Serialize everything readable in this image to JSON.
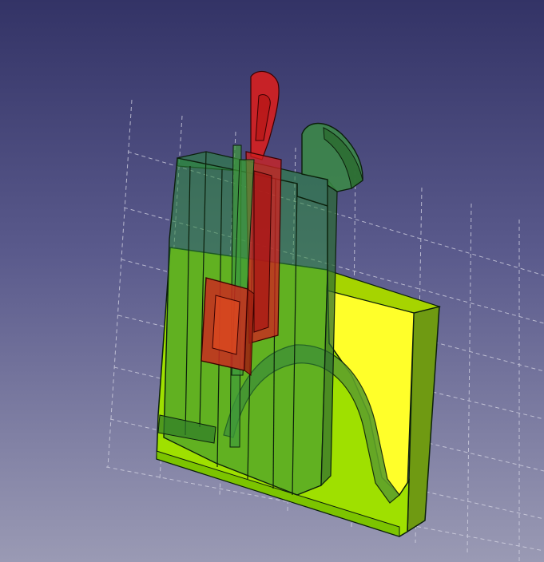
{
  "viewport": {
    "view": "3D model view",
    "background": {
      "top": "#333366",
      "bottom": "#9a9ab4"
    },
    "grid": {
      "visible": true,
      "color": "#d8d8e6"
    }
  },
  "model": {
    "colors": {
      "base_lime": "#9fe000",
      "base_yellow": "#ffff2a",
      "side_olive": "#6f9a12",
      "translucent_green": "#2d7f45",
      "edge": "#0b1f0b",
      "lever_red": "#d61f1f",
      "slider_red": "#c92b1f"
    }
  }
}
